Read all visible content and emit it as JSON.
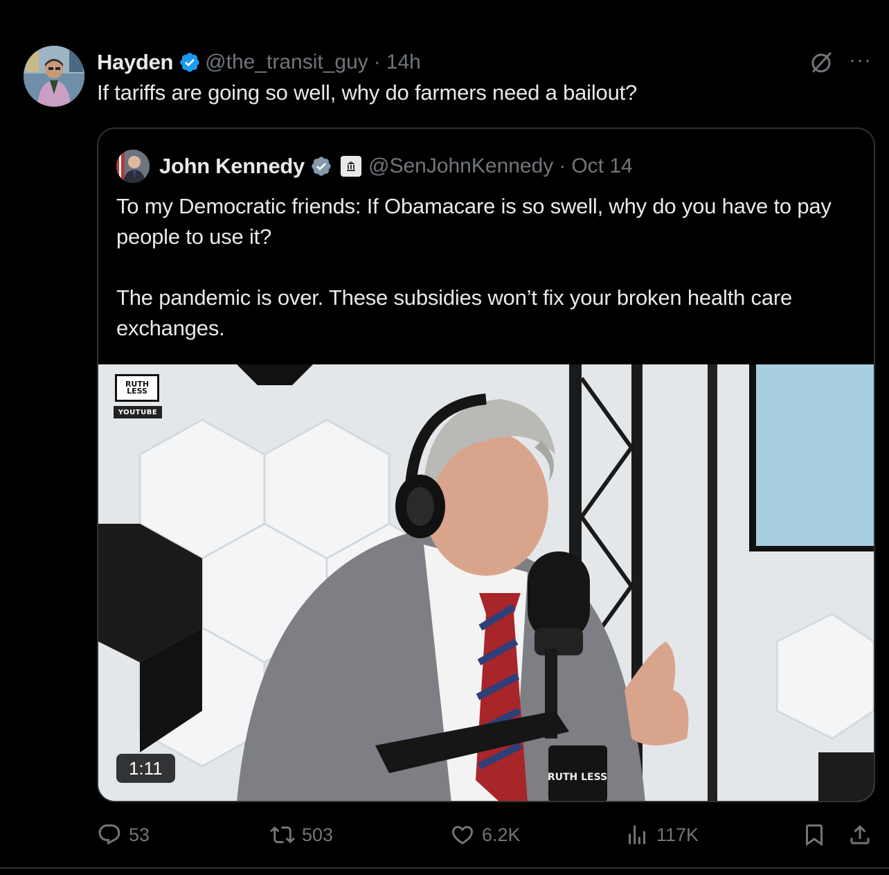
{
  "tweet": {
    "author_name": "Hayden",
    "author_handle": "@the_transit_guy",
    "separator": "·",
    "time": "14h",
    "text": "If tariffs are going so well, why do farmers need a bailout?",
    "more_label": "···"
  },
  "quoted": {
    "author_name": "John Kennedy",
    "author_handle": "@SenJohnKennedy",
    "separator": "·",
    "time": "Oct 14",
    "paragraphs": [
      "To my Democratic friends: If Obamacare is so swell, why do you have to pay people to use it?",
      "The pandemic is over. These subsidies won’t fix your broken health care exchanges."
    ],
    "video": {
      "duration": "1:11",
      "watermark_top": "RUTH LESS",
      "watermark_bottom": "YOUTUBE",
      "mug_text": "RUTH LESS"
    }
  },
  "actions": {
    "replies": "53",
    "reposts": "503",
    "likes": "6.2K",
    "views": "117K"
  },
  "colors": {
    "background": "#000000",
    "text_primary": "#e7e9ea",
    "text_secondary": "#71767b",
    "verified_blue": "#1d9bf0",
    "border": "#2f3336"
  }
}
